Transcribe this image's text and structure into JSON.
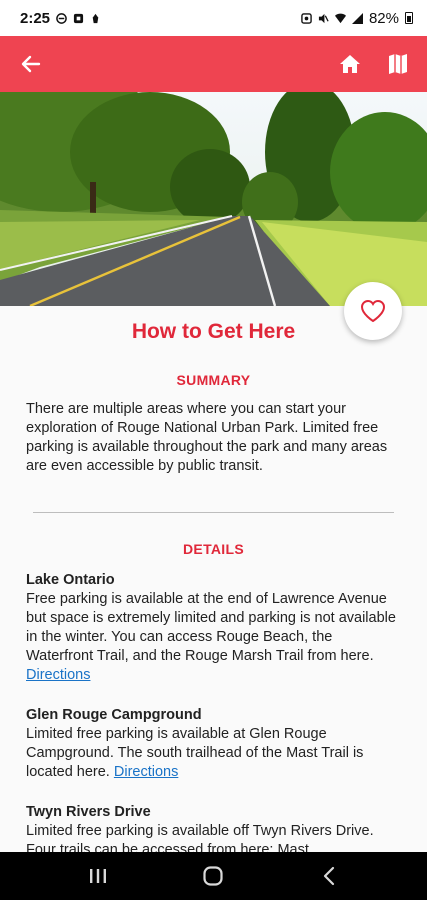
{
  "status_bar": {
    "time": "2:25",
    "battery": "82%"
  },
  "app_bar": {
    "back_icon": "arrow-left-icon",
    "home_icon": "home-icon",
    "map_icon": "map-icon",
    "color": "#ef4451"
  },
  "page": {
    "title": "How to Get Here",
    "summary_heading": "SUMMARY",
    "summary_text": "There are multiple areas where you can start your exploration of Rouge National Urban Park. Limited free parking is available throughout the park and many areas are even accessible by public transit.",
    "details_heading": "DETAILS",
    "details": [
      {
        "title": "Lake Ontario",
        "text": "Free parking is available at the end of Lawrence Avenue but space is extremely limited and parking is not available in the winter. You can access Rouge Beach, the Waterfront Trail, and the Rouge Marsh Trail from here. ",
        "link": "Directions"
      },
      {
        "title": "Glen Rouge Campground",
        "text": "Limited free parking is available at Glen Rouge Campground. The south trailhead of the Mast Trail is located here. ",
        "link": "Directions"
      },
      {
        "title": "Twyn Rivers Drive",
        "text": "Limited free parking is available off Twyn Rivers Drive. Four trails can be accessed from here: Mast",
        "link": ""
      }
    ]
  },
  "colors": {
    "accent": "#ef4451",
    "heading": "#e0283a",
    "link": "#1a73c7"
  },
  "nav_bar": {
    "recents_icon": "recents-icon",
    "home_icon": "home-circle-icon",
    "back_icon": "back-chevron-icon"
  }
}
